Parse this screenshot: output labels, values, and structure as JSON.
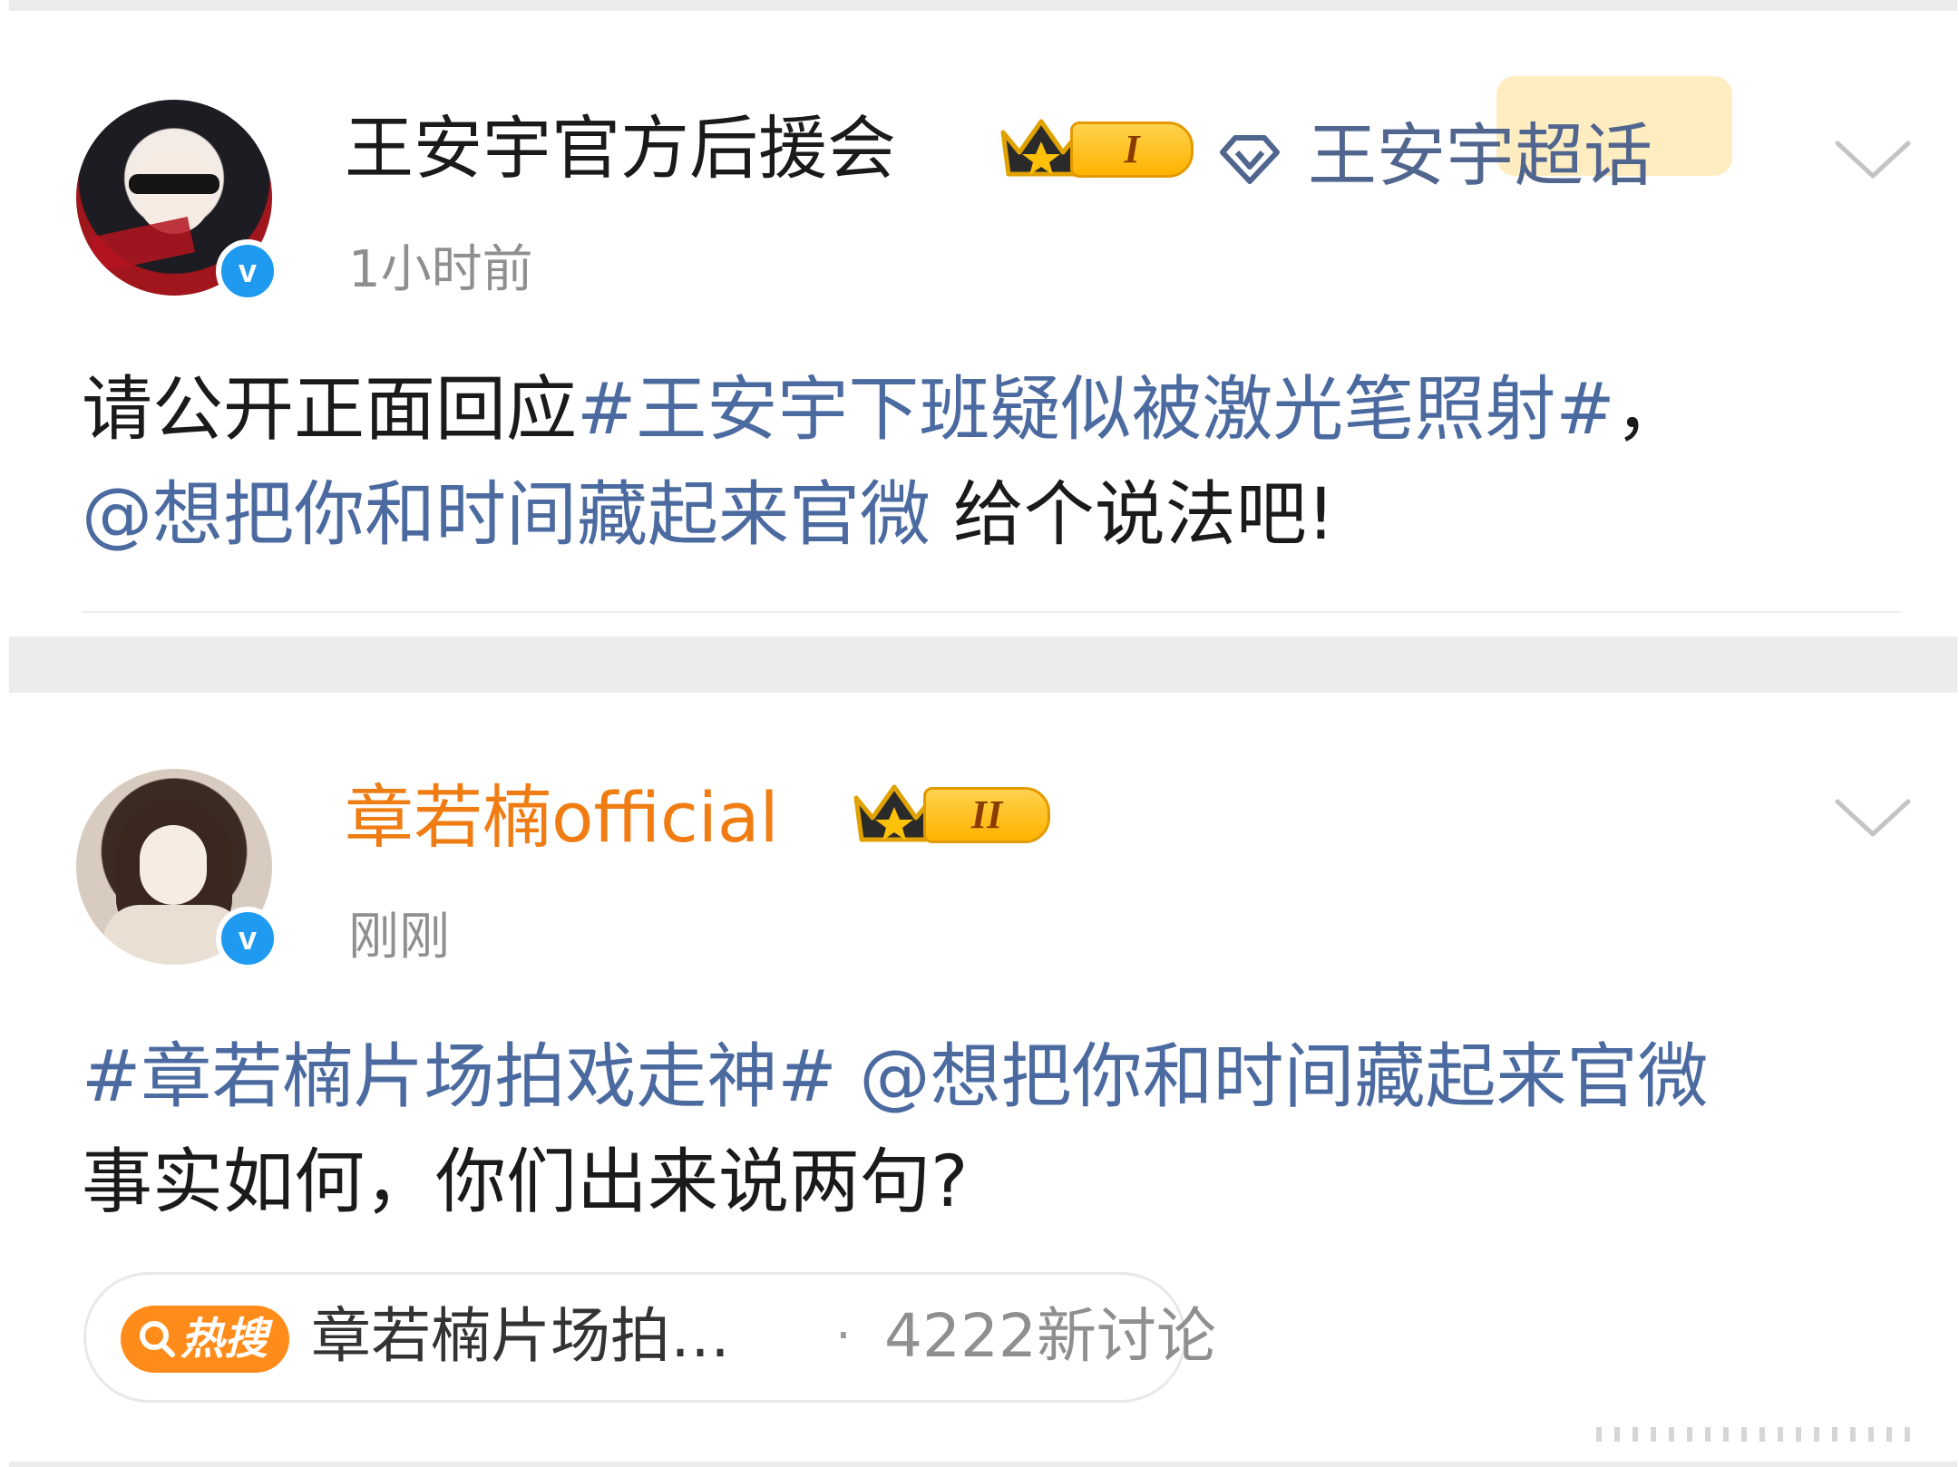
{
  "colors": {
    "link": "#4b6aa0",
    "vip_name": "#f07d14",
    "supertopic": "#51668f",
    "verified": "#1e9bf0",
    "hot_badge": "#ff8c1a",
    "separator": "#ececec"
  },
  "posts": [
    {
      "author": "王安宇官方后援会",
      "level_badge": "I",
      "supertopic": "王安宇超话",
      "supertopic_icon": "diamond-icon",
      "time": "1小时前",
      "verified": true,
      "body": {
        "line1_prefix": "请公开正面回应",
        "line1_hashtag": "#王安宇下班疑似被激光笔照射#",
        "line1_suffix": "，",
        "line2_mention": "@想把你和时间藏起来官微",
        "line2_suffix": " 给个说法吧!"
      }
    },
    {
      "author": "章若楠official",
      "level_badge": "II",
      "time": "刚刚",
      "verified": true,
      "body": {
        "line1_hashtag": "#章若楠片场拍戏走神#",
        "line1_mention": " @想把你和时间藏起来官微",
        "line2_text": "事实如何，你们出来说两句?"
      },
      "hot_search": {
        "badge_label": "热搜",
        "title": "章若楠片场拍…",
        "separator": "·",
        "count_text": "4222新讨论"
      }
    }
  ]
}
